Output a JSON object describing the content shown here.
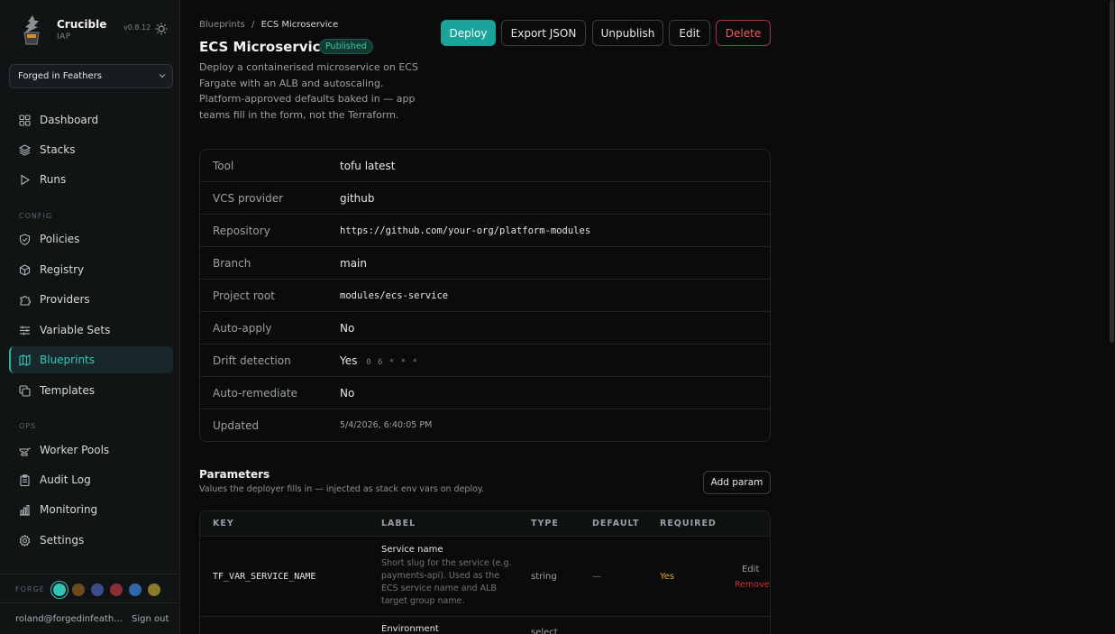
{
  "sidebar": {
    "brand": "Crucible",
    "brand_sub": "IAP",
    "version": "v0.8.12",
    "org": "Forged in Feathers",
    "sections": {
      "config": "CONFIG",
      "ops": "OPS"
    },
    "items": [
      {
        "label": "Dashboard",
        "icon": "grid-icon"
      },
      {
        "label": "Stacks",
        "icon": "layers-icon"
      },
      {
        "label": "Runs",
        "icon": "play-icon"
      },
      {
        "label": "Policies",
        "icon": "shield-icon"
      },
      {
        "label": "Registry",
        "icon": "cube-icon"
      },
      {
        "label": "Providers",
        "icon": "puzzle-icon"
      },
      {
        "label": "Variable Sets",
        "icon": "sliders-icon"
      },
      {
        "label": "Blueprints",
        "icon": "map-icon"
      },
      {
        "label": "Templates",
        "icon": "copy-icon"
      },
      {
        "label": "Worker Pools",
        "icon": "anvil-icon"
      },
      {
        "label": "Audit Log",
        "icon": "clipboard-icon"
      },
      {
        "label": "Monitoring",
        "icon": "bar-chart-icon"
      },
      {
        "label": "Settings",
        "icon": "gear-icon"
      }
    ],
    "forge_label": "FORGE",
    "forge_colors": [
      "#2fc4b4",
      "#6b4a1e",
      "#3d4c8a",
      "#8a2f36",
      "#2f67a8",
      "#8a7a2a"
    ],
    "user_email": "roland@forgedinfeathers.com",
    "signout": "Sign out"
  },
  "header": {
    "breadcrumb_root": "Blueprints",
    "breadcrumb_sep": "/",
    "breadcrumb_current": "ECS Microservice",
    "title": "ECS Microservice",
    "status": "Published",
    "description": "Deploy a containerised microservice on ECS Fargate with an ALB and autoscaling. Platform-approved defaults baked in — app teams fill in the form, not the Terraform.",
    "actions": {
      "deploy": "Deploy",
      "export": "Export JSON",
      "unpublish": "Unpublish",
      "edit": "Edit",
      "delete": "Delete"
    }
  },
  "details": [
    {
      "key": "Tool",
      "value": "tofu latest"
    },
    {
      "key": "VCS provider",
      "value": "github"
    },
    {
      "key": "Repository",
      "value": "https://github.com/your-org/platform-modules"
    },
    {
      "key": "Branch",
      "value": "main"
    },
    {
      "key": "Project root",
      "value": "modules/ecs-service"
    },
    {
      "key": "Auto-apply",
      "value": "No"
    },
    {
      "key": "Drift detection",
      "value": "Yes",
      "extra": "0 6 * * *"
    },
    {
      "key": "Auto-remediate",
      "value": "No"
    },
    {
      "key": "Updated",
      "value": "5/4/2026, 6:40:05 PM"
    }
  ],
  "parameters": {
    "title": "Parameters",
    "subtitle": "Values the deployer fills in — injected as stack env vars on deploy.",
    "add_button": "Add param",
    "columns": [
      "KEY",
      "LABEL",
      "TYPE",
      "DEFAULT",
      "REQUIRED"
    ],
    "rows": [
      {
        "key": "TF_VAR_SERVICE_NAME",
        "label": "Service name",
        "help": "Short slug for the service (e.g. payments-api). Used as the ECS service name and ALB target group name.",
        "type": "string",
        "default": "—",
        "required": "Yes",
        "edit": "Edit",
        "remove": "Remove"
      },
      {
        "label": "Environment",
        "type": "select"
      }
    ]
  }
}
